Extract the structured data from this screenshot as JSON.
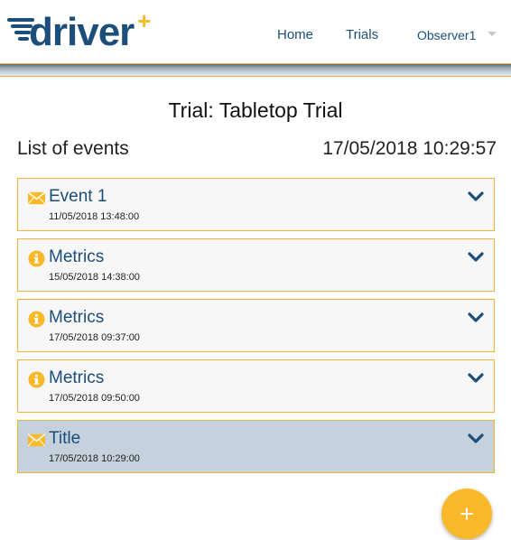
{
  "header": {
    "logo_text": "driver",
    "logo_plus": "+",
    "nav": {
      "home": "Home",
      "trials": "Trials",
      "user": "Observer1"
    }
  },
  "main": {
    "trial_title": "Trial: Tabletop Trial",
    "list_title": "List of events",
    "current_time": "17/05/2018 10:29:57",
    "events": [
      {
        "icon": "envelope-icon",
        "title": "Event 1",
        "date": "11/05/2018 13:48:00",
        "selected": false
      },
      {
        "icon": "info-icon",
        "title": "Metrics",
        "date": "15/05/2018 14:38:00",
        "selected": false
      },
      {
        "icon": "info-icon",
        "title": "Metrics",
        "date": "17/05/2018 09:37:00",
        "selected": false
      },
      {
        "icon": "info-icon",
        "title": "Metrics",
        "date": "17/05/2018 09:50:00",
        "selected": false
      },
      {
        "icon": "envelope-icon",
        "title": "Title",
        "date": "17/05/2018 10:29:00",
        "selected": true
      }
    ]
  },
  "colors": {
    "accent": "#f9b928",
    "brand_blue": "#1b4e7a",
    "selected_bg": "#c5d1dc",
    "card_border": "#f0b534"
  },
  "fab": {
    "icon": "plus-icon"
  }
}
